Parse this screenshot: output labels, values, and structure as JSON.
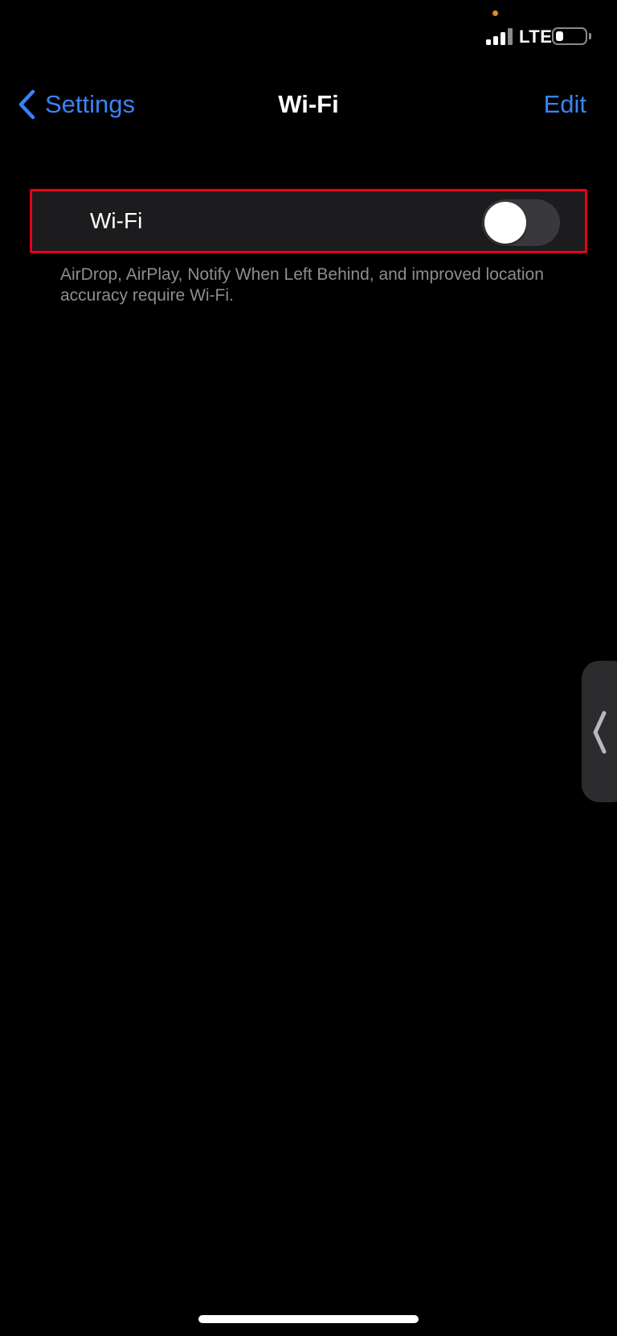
{
  "status_bar": {
    "network_type": "LTE",
    "battery_level": 0.25,
    "privacy_dot_color": "#e08a2a"
  },
  "nav": {
    "back_label": "Settings",
    "title": "Wi-Fi",
    "edit_label": "Edit",
    "accent_color": "#3b82f6"
  },
  "wifi": {
    "label": "Wi-Fi",
    "enabled": false,
    "footnote": "AirDrop, AirPlay, Notify When Left Behind, and improved location accuracy require Wi-Fi."
  },
  "icons": {
    "back": "chevron-left-icon",
    "side_handle": "chevron-left-icon"
  }
}
